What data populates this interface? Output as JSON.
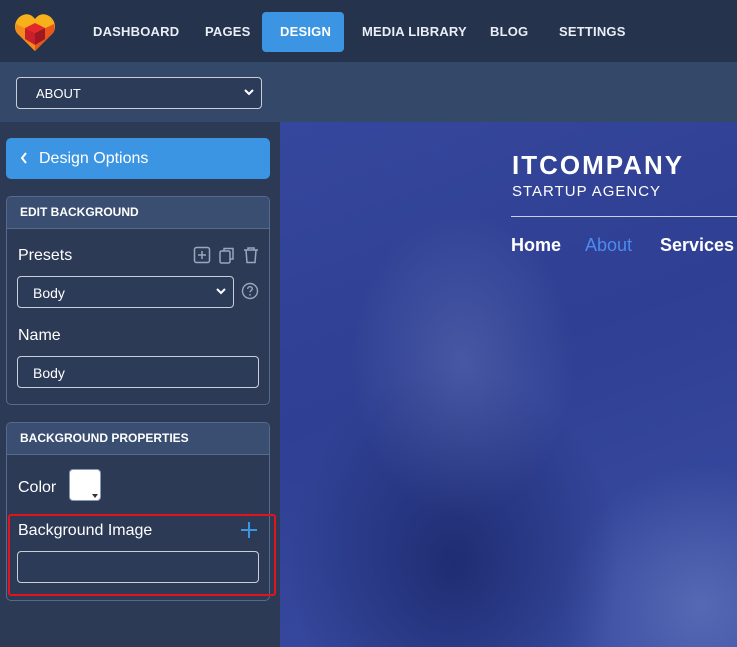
{
  "nav": {
    "items": [
      {
        "label": "DASHBOARD"
      },
      {
        "label": "PAGES"
      },
      {
        "label": "DESIGN",
        "active": true
      },
      {
        "label": "MEDIA LIBRARY"
      },
      {
        "label": "BLOG"
      },
      {
        "label": "SETTINGS"
      }
    ]
  },
  "page_select": {
    "value": "ABOUT"
  },
  "sidebar": {
    "design_options_label": "Design Options",
    "edit_background": {
      "title": "EDIT BACKGROUND",
      "presets_label": "Presets",
      "presets_value": "Body",
      "name_label": "Name",
      "name_value": "Body"
    },
    "background_properties": {
      "title": "BACKGROUND PROPERTIES",
      "color_label": "Color",
      "color_value": "#ffffff",
      "bg_image_label": "Background Image",
      "bg_image_value": ""
    }
  },
  "preview": {
    "brand": "ITCOMPANY",
    "tagline": "STARTUP AGENCY",
    "menu": [
      {
        "label": "Home"
      },
      {
        "label": "About",
        "active": true
      },
      {
        "label": "Services"
      }
    ]
  },
  "colors": {
    "accent": "#3b95e3",
    "highlight": "#e1141b",
    "topbar": "#26334d",
    "panel": "#2c3a55"
  },
  "icons": {
    "logo": "heart-cube-logo",
    "add": "plus-square-icon",
    "copy": "copy-icon",
    "delete": "trash-icon",
    "help": "question-circle-icon",
    "add_image": "plus-icon",
    "back": "chevron-left-icon",
    "dropdown": "chevron-down-icon"
  }
}
